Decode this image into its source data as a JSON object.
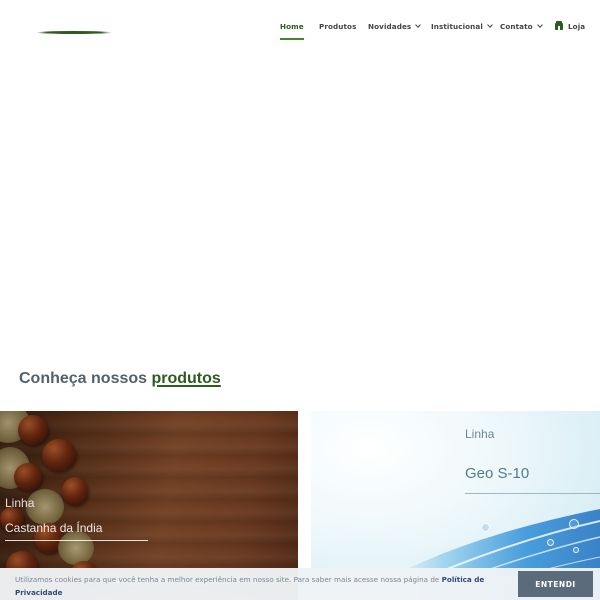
{
  "header": {
    "nav": [
      {
        "label": "Home",
        "active": true,
        "has_dropdown": false
      },
      {
        "label": "Produtos",
        "active": false,
        "has_dropdown": false
      },
      {
        "label": "Novidades",
        "active": false,
        "has_dropdown": true
      },
      {
        "label": "Institucional",
        "active": false,
        "has_dropdown": true
      },
      {
        "label": "Contato",
        "active": false,
        "has_dropdown": true
      },
      {
        "label": "Loja",
        "active": false,
        "has_dropdown": false,
        "icon": "store-icon"
      }
    ]
  },
  "products_section": {
    "title_prefix": "Conheça nossos",
    "title_highlight": "produtos",
    "cards": [
      {
        "label": "Linha",
        "name": "Castanha da Índia"
      },
      {
        "label": "Linha",
        "name": "Geo S-10"
      }
    ]
  },
  "cookie_bar": {
    "text": "Utilizamos cookies para que você tenha a melhor experiência em nosso site. Para saber mais acesse nossa página de",
    "link_text": "Política de Privacidade",
    "button_label": "ENTENDI"
  },
  "colors": {
    "brand_green": "#2e5b20",
    "active_underline": "#3f8a2b",
    "cookie_button": "#5b6b7b"
  }
}
